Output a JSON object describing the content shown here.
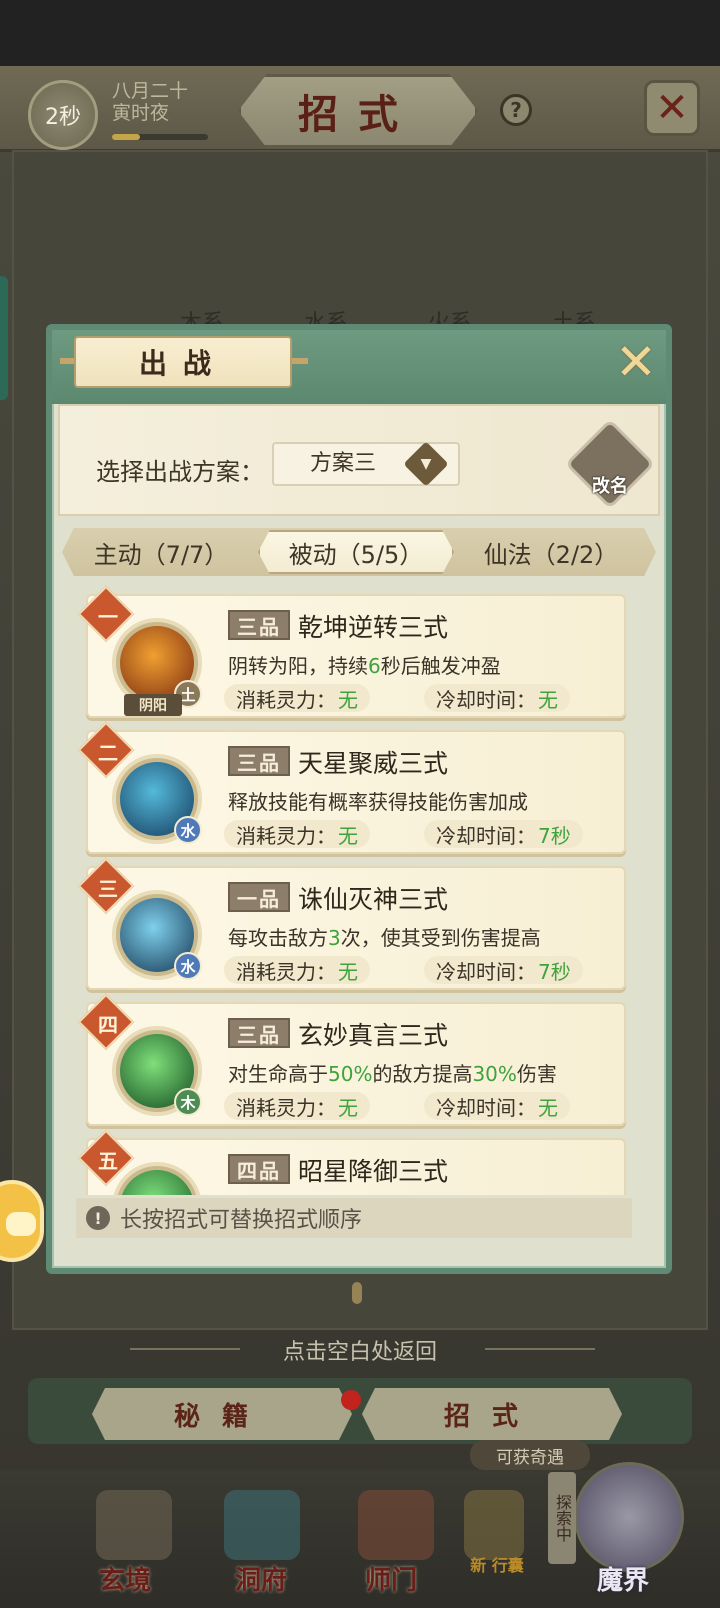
{
  "header": {
    "timer": "2秒",
    "date_line1": "八月二十",
    "date_line2": "寅时夜",
    "date_progress": 0.3,
    "title": "招式",
    "help_icon": "question-icon",
    "close_icon": "close-icon"
  },
  "background_tabs": [
    "木系",
    "水系",
    "火系",
    "土系"
  ],
  "modal": {
    "title": "出战",
    "close_icon": "close-x-icon",
    "scheme_label": "选择出战方案：",
    "scheme_value": "方案三",
    "rename_label": "改名",
    "tabs": [
      {
        "label": "主动（7/7）",
        "active": false
      },
      {
        "label": "被动（5/5）",
        "active": true
      },
      {
        "label": "仙法（2/2）",
        "active": false
      }
    ],
    "cost_label": "消耗灵力：",
    "cooldown_label": "冷却时间：",
    "skills": [
      {
        "rank": "一",
        "grade": "三品",
        "name": "乾坤逆转三式",
        "desc_parts": [
          "阴转为阳，持续",
          "6",
          "秒后触发冲盈"
        ],
        "cost": "无",
        "cooldown": "无",
        "element": "土",
        "element_color": "#8a7a5a",
        "badge": "阴阳",
        "icon_colors": [
          "#f0a030",
          "#7a2a10"
        ]
      },
      {
        "rank": "二",
        "grade": "三品",
        "name": "天星聚威三式",
        "desc_parts": [
          "释放技能有概率获得技能伤害加成",
          "",
          ""
        ],
        "cost": "无",
        "cooldown": "7秒",
        "element": "水",
        "element_color": "#4f79b8",
        "badge": "",
        "icon_colors": [
          "#55b9d9",
          "#143a5c"
        ]
      },
      {
        "rank": "三",
        "grade": "一品",
        "name": "诛仙灭神三式",
        "desc_parts": [
          "每攻击敌方",
          "3",
          "次，使其受到伤害提高"
        ],
        "cost": "无",
        "cooldown": "7秒",
        "element": "水",
        "element_color": "#4f79b8",
        "badge": "",
        "icon_colors": [
          "#7fd0ec",
          "#153651"
        ]
      },
      {
        "rank": "四",
        "grade": "三品",
        "name": "玄妙真言三式",
        "desc_parts": [
          "对生命高于",
          "50%",
          "的敌方提高",
          "30%",
          "伤害"
        ],
        "cost": "无",
        "cooldown": "无",
        "element": "木",
        "element_color": "#4e8b55",
        "badge": "",
        "icon_colors": [
          "#7fe07a",
          "#134a20"
        ]
      },
      {
        "rank": "五",
        "grade": "四品",
        "name": "昭星降御三式",
        "desc_parts": [
          "",
          "",
          ""
        ],
        "cost": "",
        "cooldown": "",
        "element": "",
        "element_color": "#4e8b55",
        "badge": "",
        "icon_colors": [
          "#7fe07a",
          "#1a5a2a"
        ]
      }
    ],
    "tip": "长按招式可替换招式顺序"
  },
  "return_hint": "点击空白处返回",
  "bottom_tabs": [
    "秘籍",
    "招式"
  ],
  "opportunity": "可获奇遇",
  "explore_badge": "探索中",
  "nav": [
    "玄境",
    "洞府",
    "师门",
    "",
    "魔界"
  ],
  "nav_extra_badge": "新 行囊"
}
